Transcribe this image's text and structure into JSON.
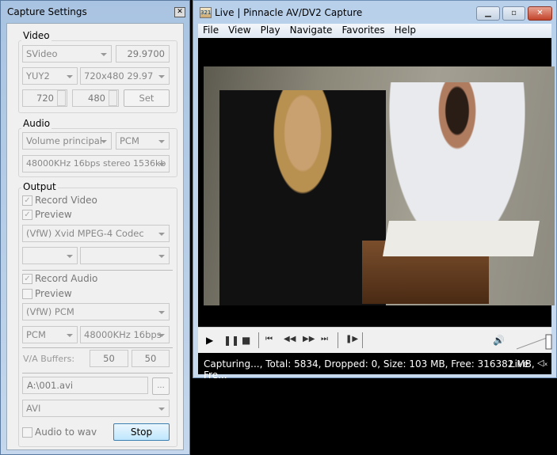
{
  "settings": {
    "title": "Capture Settings",
    "video": {
      "label": "Video",
      "input": "SVideo",
      "fps": "29.9700",
      "format": "YUY2",
      "resolution": "720x480 29.97",
      "width": "720",
      "height": "480",
      "set": "Set"
    },
    "audio": {
      "label": "Audio",
      "input": "Volume principal",
      "format": "PCM",
      "quality": "48000KHz 16bps stereo 1536kb"
    },
    "output": {
      "label": "Output",
      "record_video": "Record Video",
      "preview_video": "Preview",
      "video_codec": "(VfW) Xvid MPEG-4 Codec",
      "record_audio": "Record Audio",
      "preview_audio": "Preview",
      "audio_codec": "(VfW) PCM",
      "audio_format": "PCM",
      "audio_quality": "48000KHz 16bps",
      "buffers_label": "V/A Buffers:",
      "video_buffer": "50",
      "audio_buffer": "50",
      "filename": "A:\\001.avi",
      "browse": "...",
      "container": "AVI",
      "audio_to_wav": "Audio to wav",
      "stop": "Stop"
    }
  },
  "player": {
    "title": "Live | Pinnacle AV/DV2 Capture",
    "menu": [
      "File",
      "View",
      "Play",
      "Navigate",
      "Favorites",
      "Help"
    ],
    "status": "Capturing..., Total: 5834, Dropped: 0, Size: 103 MB, Free: 316382 MB, Fre...",
    "mode": "Live",
    "volume": 1.0
  }
}
